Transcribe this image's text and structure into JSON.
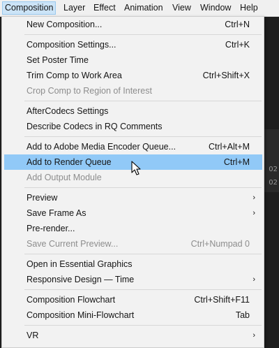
{
  "menubar": {
    "items": [
      {
        "label": "Composition"
      },
      {
        "label": "Layer"
      },
      {
        "label": "Effect"
      },
      {
        "label": "Animation"
      },
      {
        "label": "View"
      },
      {
        "label": "Window"
      },
      {
        "label": "Help"
      }
    ]
  },
  "background": {
    "values": [
      "02",
      "02"
    ]
  },
  "menu": {
    "items": [
      {
        "label": "New Composition...",
        "shortcut": "Ctrl+N",
        "enabled": true
      },
      {
        "label": "Composition Settings...",
        "shortcut": "Ctrl+K",
        "enabled": true
      },
      {
        "label": "Set Poster Time",
        "shortcut": "",
        "enabled": true
      },
      {
        "label": "Trim Comp to Work Area",
        "shortcut": "Ctrl+Shift+X",
        "enabled": true
      },
      {
        "label": "Crop Comp to Region of Interest",
        "shortcut": "",
        "enabled": false
      },
      {
        "label": "AfterCodecs Settings",
        "shortcut": "",
        "enabled": true
      },
      {
        "label": "Describe Codecs in RQ Comments",
        "shortcut": "",
        "enabled": true
      },
      {
        "label": "Add to Adobe Media Encoder Queue...",
        "shortcut": "Ctrl+Alt+M",
        "enabled": true
      },
      {
        "label": "Add to Render Queue",
        "shortcut": "Ctrl+M",
        "enabled": true,
        "highlighted": true
      },
      {
        "label": "Add Output Module",
        "shortcut": "",
        "enabled": false
      },
      {
        "label": "Preview",
        "shortcut": "",
        "enabled": true,
        "submenu": true
      },
      {
        "label": "Save Frame As",
        "shortcut": "",
        "enabled": true,
        "submenu": true
      },
      {
        "label": "Pre-render...",
        "shortcut": "",
        "enabled": true
      },
      {
        "label": "Save Current Preview...",
        "shortcut": "Ctrl+Numpad 0",
        "enabled": false
      },
      {
        "label": "Open in Essential Graphics",
        "shortcut": "",
        "enabled": true
      },
      {
        "label": "Responsive Design — Time",
        "shortcut": "",
        "enabled": true,
        "submenu": true
      },
      {
        "label": "Composition Flowchart",
        "shortcut": "Ctrl+Shift+F11",
        "enabled": true
      },
      {
        "label": "Composition Mini-Flowchart",
        "shortcut": "Tab",
        "enabled": true
      },
      {
        "label": "VR",
        "shortcut": "",
        "enabled": true,
        "submenu": true
      }
    ],
    "submenu_arrow": "›"
  },
  "colors": {
    "menu_bg": "#f2f2f2",
    "highlight": "#91c9f7",
    "disabled_text": "#8d8d8d",
    "menubar_active": "#cce4f7"
  }
}
